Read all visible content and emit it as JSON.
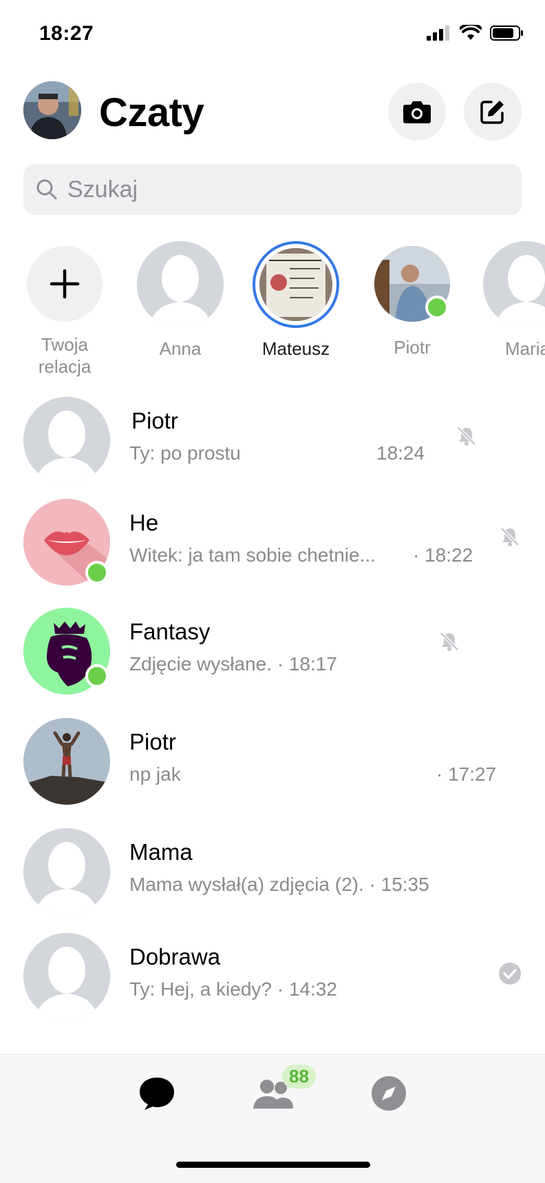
{
  "status_bar": {
    "time": "18:27"
  },
  "header": {
    "title": "Czaty"
  },
  "search": {
    "placeholder": "Szukaj"
  },
  "stories": [
    {
      "label_line1": "Twoja",
      "label_line2": "relacja"
    },
    {
      "label": "Anna"
    },
    {
      "label": "Mateusz"
    },
    {
      "label": "Piotr"
    },
    {
      "label": "Maria"
    }
  ],
  "chats": [
    {
      "name": "Piotr",
      "preview": "Ty: po prostu",
      "time": "18:24",
      "status_icon": "muted-bell-icon"
    },
    {
      "name": "He",
      "preview": "Witek: ja tam sobie chetnie...",
      "time": "· 18:22",
      "status_icon": "muted-bell-icon"
    },
    {
      "name": "Fantasy",
      "preview": "Zdjęcie wysłane. · 18:17",
      "time": "",
      "status_icon": "muted-bell-icon"
    },
    {
      "name": "Piotr",
      "preview": "np jak",
      "time": "· 17:27",
      "status_icon": ""
    },
    {
      "name": "Mama",
      "preview": "Mama wysłał(a) zdjęcia (2). · 15:35",
      "time": "",
      "status_icon": ""
    },
    {
      "name": "Dobrawa",
      "preview": "Ty: Hej, a kiedy? · 14:32",
      "time": "",
      "status_icon": "seen-check-icon"
    }
  ],
  "tab_bar": {
    "people_badge": "88"
  },
  "colors": {
    "accent": "#3578e5",
    "online": "#6bcf4a",
    "badge_text": "#58b43b"
  }
}
